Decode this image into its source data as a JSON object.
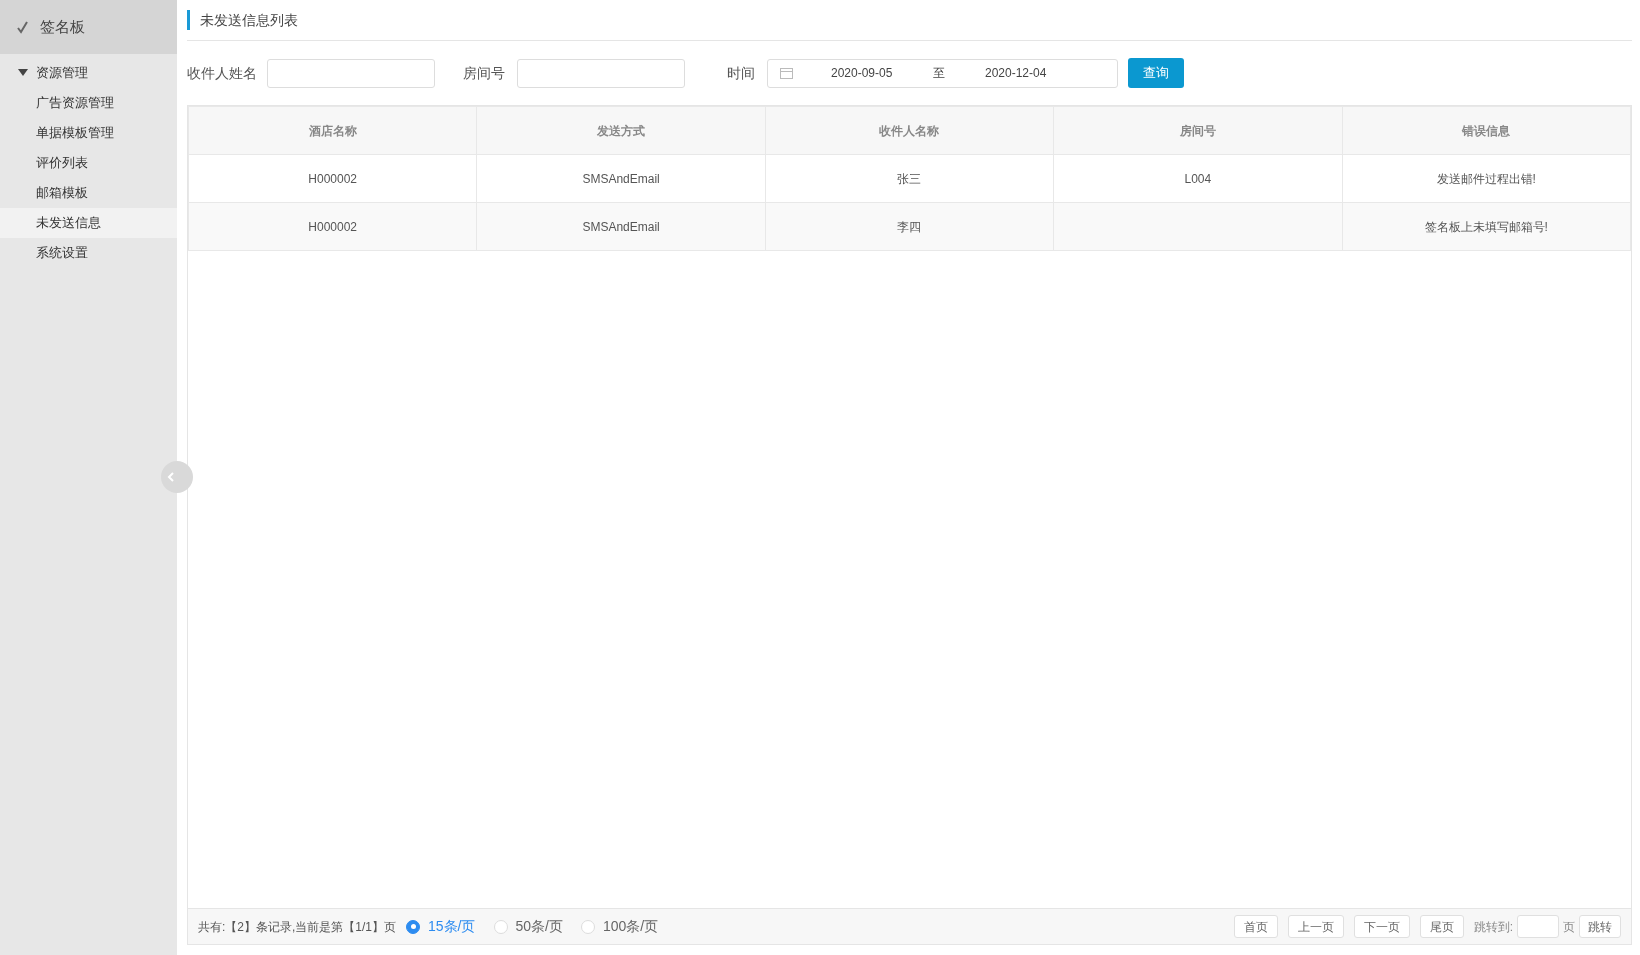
{
  "sidebar": {
    "title": "签名板",
    "groups": [
      {
        "label": "资源管理",
        "expanded": true,
        "children": [
          {
            "label": "广告资源管理",
            "selected": false
          },
          {
            "label": "单据模板管理",
            "selected": false
          },
          {
            "label": "评价列表",
            "selected": false
          },
          {
            "label": "邮箱模板",
            "selected": false
          },
          {
            "label": "未发送信息",
            "selected": true
          },
          {
            "label": "系统设置",
            "selected": false
          }
        ]
      }
    ]
  },
  "page_title": "未发送信息列表",
  "filters": {
    "recipient_label": "收件人姓名",
    "room_label": "房间号",
    "time_label": "时间",
    "date_from": "2020-09-05",
    "date_sep": "至",
    "date_to": "2020-12-04",
    "query_button": "查询"
  },
  "table": {
    "columns": [
      "酒店名称",
      "发送方式",
      "收件人名称",
      "房间号",
      "错误信息"
    ],
    "rows": [
      [
        "H000002",
        "SMSAndEmail",
        "张三",
        "L004",
        "发送邮件过程出错!"
      ],
      [
        "H000002",
        "SMSAndEmail",
        "李四",
        "",
        "签名板上未填写邮箱号!"
      ]
    ]
  },
  "pager": {
    "summary": "共有:【2】条记录,当前是第【1/1】页",
    "sizes": [
      {
        "label": "15条/页",
        "selected": true
      },
      {
        "label": "50条/页",
        "selected": false
      },
      {
        "label": "100条/页",
        "selected": false
      }
    ],
    "buttons": [
      "首页",
      "上一页",
      "下一页",
      "尾页"
    ],
    "jump_label": "跳转到:",
    "page_unit": "页",
    "jump_button": "跳转"
  }
}
